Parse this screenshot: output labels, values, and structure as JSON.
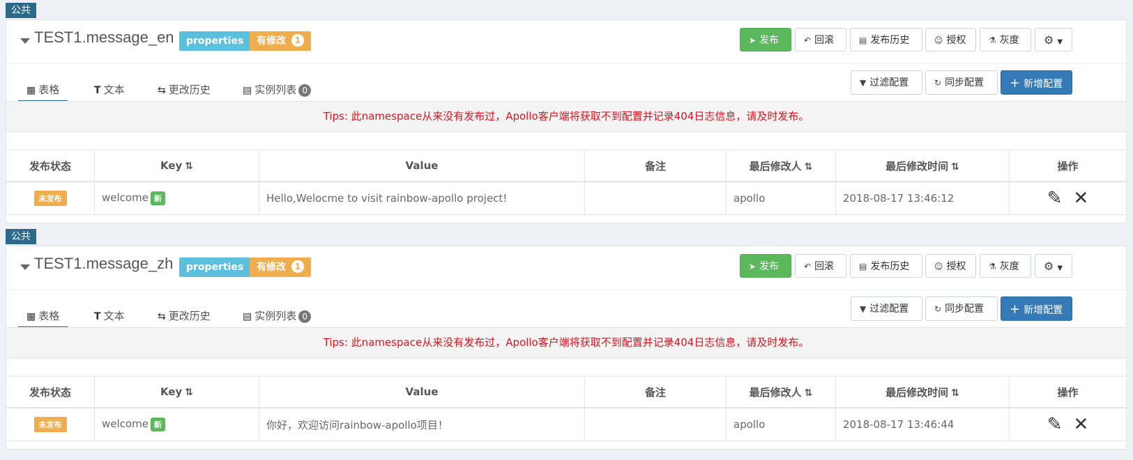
{
  "namespaces": [
    {
      "tag": "公共",
      "name": "TEST1.message_en",
      "format": "properties",
      "modified_label": "有修改",
      "modified_count": "1",
      "buttons": {
        "publish": "发布",
        "rollback": "回滚",
        "history": "发布历史",
        "grant": "授权",
        "gray": "灰度"
      },
      "tabs": {
        "table": "表格",
        "text": "文本",
        "change_history": "更改历史",
        "instances": "实例列表",
        "instance_count": "0"
      },
      "actions": {
        "filter": "过滤配置",
        "sync": "同步配置",
        "add": "新增配置"
      },
      "tips": "Tips: 此namespace从来没有发布过，Apollo客户端将获取不到配置并记录404日志信息，请及时发布。",
      "columns": [
        "发布状态",
        "Key",
        "Value",
        "备注",
        "最后修改人",
        "最后修改时间",
        "操作"
      ],
      "rows": [
        {
          "status": "未发布",
          "key": "welcome",
          "new_label": "新",
          "value": "Hello,Welocme to visit rainbow-apollo project!",
          "comment": "",
          "modifier": "apollo",
          "time": "2018-08-17 13:46:12"
        }
      ]
    },
    {
      "tag": "公共",
      "name": "TEST1.message_zh",
      "format": "properties",
      "modified_label": "有修改",
      "modified_count": "1",
      "buttons": {
        "publish": "发布",
        "rollback": "回滚",
        "history": "发布历史",
        "grant": "授权",
        "gray": "灰度"
      },
      "tabs": {
        "table": "表格",
        "text": "文本",
        "change_history": "更改历史",
        "instances": "实例列表",
        "instance_count": "0"
      },
      "actions": {
        "filter": "过滤配置",
        "sync": "同步配置",
        "add": "新增配置"
      },
      "tips": "Tips: 此namespace从来没有发布过，Apollo客户端将获取不到配置并记录404日志信息，请及时发布。",
      "columns": [
        "发布状态",
        "Key",
        "Value",
        "备注",
        "最后修改人",
        "最后修改时间",
        "操作"
      ],
      "rows": [
        {
          "status": "未发布",
          "key": "welcome",
          "new_label": "新",
          "value": "你好，欢迎访问rainbow-apollo项目！",
          "comment": "",
          "modifier": "apollo",
          "time": "2018-08-17 13:46:44"
        }
      ]
    }
  ],
  "icons": {
    "caret": "caret-down-icon",
    "publish": "paper-plane-icon",
    "rollback": "undo-icon",
    "history": "calendar-icon",
    "grant": "user-icon",
    "gray": "flask-icon",
    "settings": "gear-icon",
    "table": "table-icon",
    "text": "text-icon",
    "change_history": "swap-icon",
    "instances": "list-icon",
    "filter": "filter-icon",
    "sync": "refresh-icon",
    "add": "plus-icon",
    "edit": "edit-icon",
    "delete": "close-icon"
  },
  "colors": {
    "tag": "#2c6a8c",
    "publish": "#5cb85c",
    "add": "#337ab7",
    "properties": "#5bc0de",
    "modified": "#f0ad4e",
    "tips": "#d9141f"
  }
}
